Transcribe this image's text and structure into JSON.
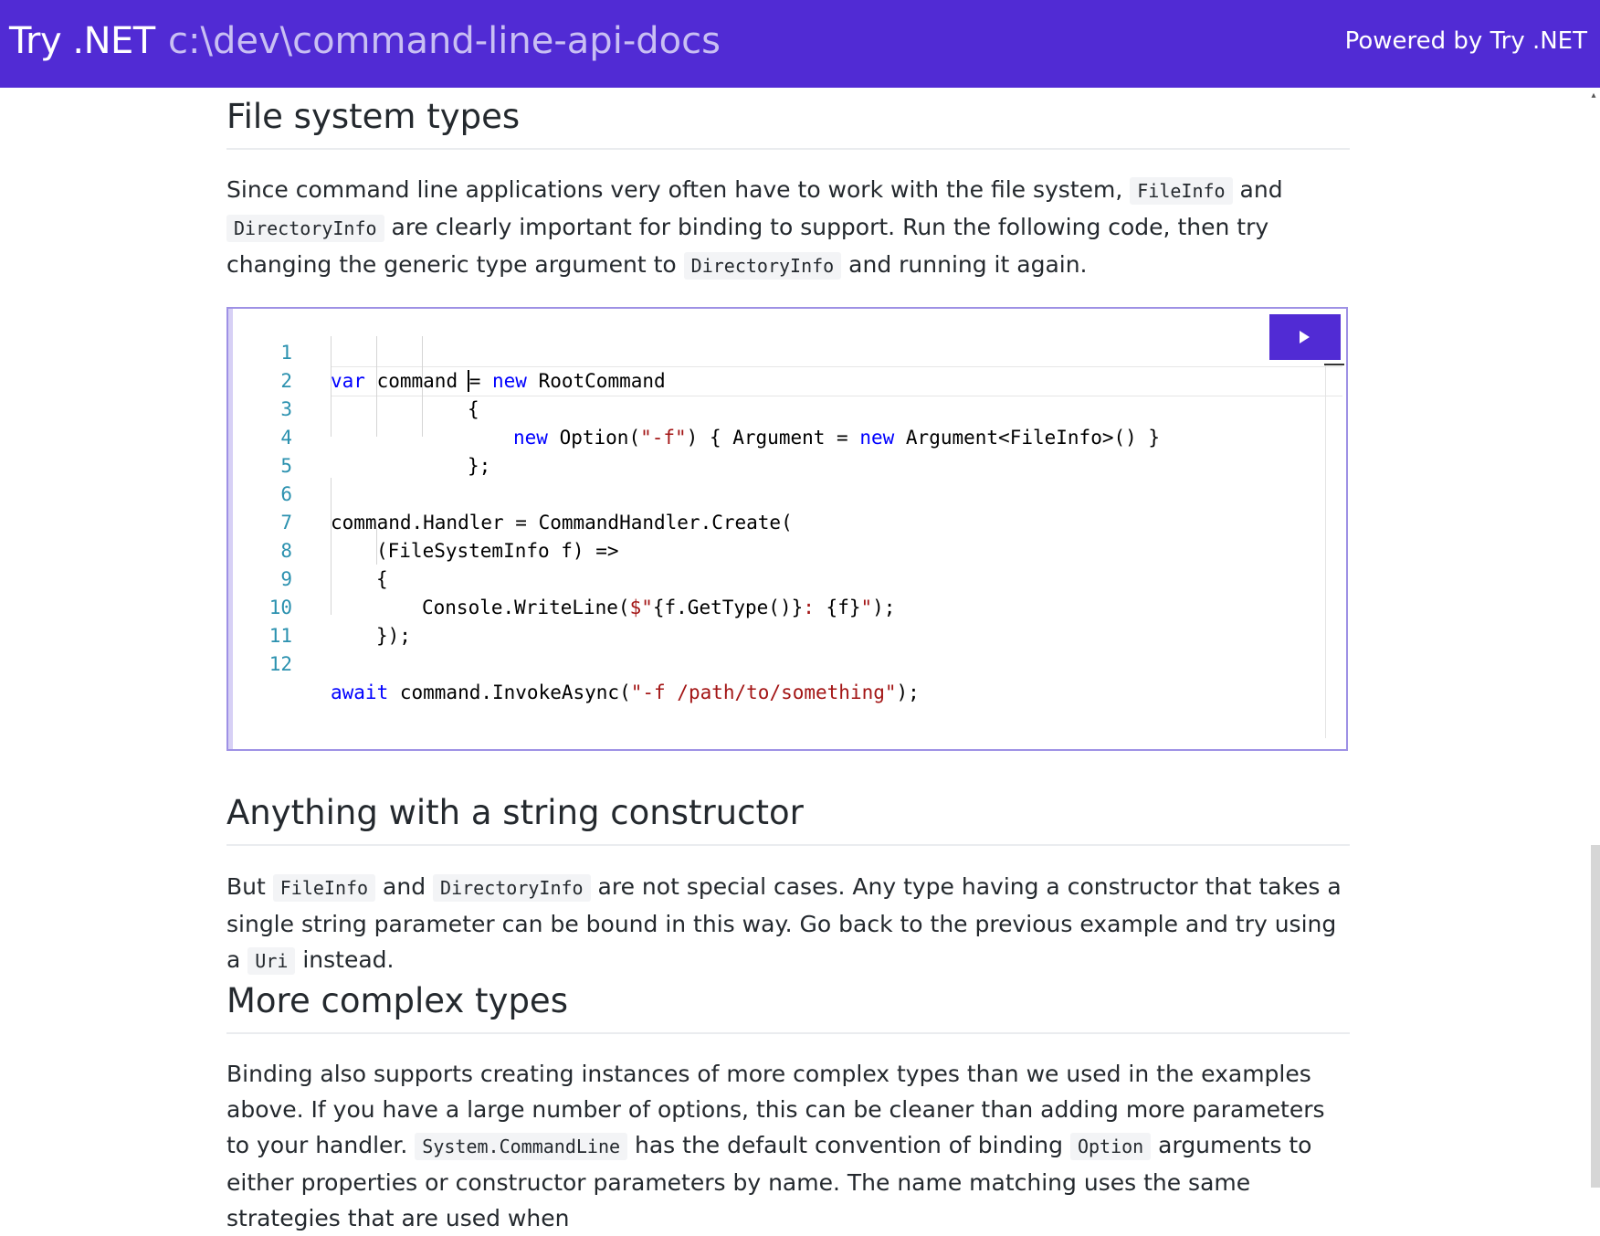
{
  "header": {
    "brand": "Try .NET",
    "path": "c:\\dev\\command-line-api-docs",
    "powered": "Powered by Try .NET"
  },
  "sections": {
    "file_system": {
      "title": "File system types",
      "p1_a": "Since command line applications very often have to work with the file system,",
      "p1_code1": "FileInfo",
      "p1_b": "and",
      "p1_code2": "DirectoryInfo",
      "p1_c": "are clearly important for binding to support. Run the following code, then try changing the generic type argument to",
      "p1_code3": "DirectoryInfo",
      "p1_d": "and running it again."
    },
    "string_ctor": {
      "title": "Anything with a string constructor",
      "p_a": "But",
      "p_code1": "FileInfo",
      "p_b": "and",
      "p_code2": "DirectoryInfo",
      "p_c": "are not special cases. Any type having a constructor that takes a single string parameter can be bound in this way. Go back to the previous example and try using a",
      "p_code3": "Uri",
      "p_d": "instead."
    },
    "complex": {
      "title": "More complex types",
      "p_a": "Binding also supports creating instances of more complex types than we used in the examples above. If you have a large number of options, this can be cleaner than adding more parameters to your handler.",
      "p_code1": "System.CommandLine",
      "p_b": "has the default convention of binding",
      "p_code2": "Option",
      "p_c": "arguments to either properties or constructor parameters by name. The name matching uses the same strategies that are used when"
    }
  },
  "editor": {
    "line_numbers": [
      "1",
      "2",
      "3",
      "4",
      "5",
      "6",
      "7",
      "8",
      "9",
      "10",
      "11",
      "12"
    ],
    "run_label": "Run",
    "code": {
      "l1_kw1": "var",
      "l1_a": " command = ",
      "l1_kw2": "new",
      "l1_b": " RootCommand",
      "l2": "{",
      "l3_kw1": "new",
      "l3_a": " Option(",
      "l3_str": "\"-f\"",
      "l3_b": ") { Argument = ",
      "l3_kw2": "new",
      "l3_c": " Argument<FileInfo>() }",
      "l4": "};",
      "l6": "command.Handler = CommandHandler.Create(",
      "l7": "(FileSystemInfo f) =>",
      "l8": "{",
      "l9_a": "Console.WriteLine(",
      "l9_str1": "$\"",
      "l9_b": "{f.GetType()}",
      "l9_str2": ": ",
      "l9_c": "{f}",
      "l9_str3": "\"",
      "l9_d": ");",
      "l10": "});",
      "l12_kw": "await",
      "l12_a": " command.InvokeAsync(",
      "l12_str": "\"-f /path/to/something\"",
      "l12_b": ");"
    }
  },
  "colors": {
    "brand": "#512bd4",
    "keyword": "#0000ff",
    "string": "#a31515",
    "line_number": "#2b91af"
  }
}
